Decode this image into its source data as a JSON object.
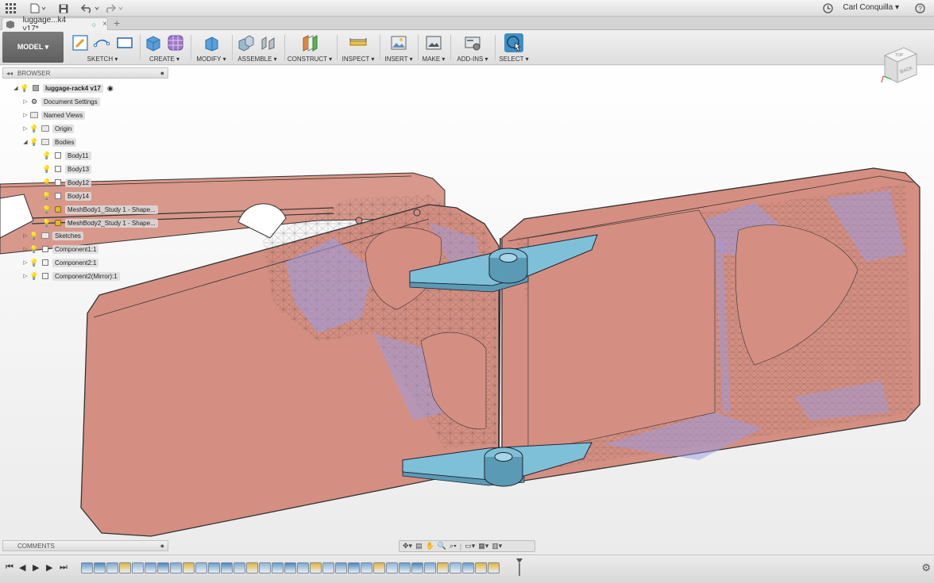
{
  "app": {
    "user_name": "Carl Conquilla ▾"
  },
  "tab": {
    "title": "luggage...k4 v17*",
    "status_dot": "○",
    "close": "×",
    "new_tab": "+"
  },
  "toolbar": {
    "model_label": "MODEL ▾",
    "groups": [
      {
        "label": "SKETCH ▾"
      },
      {
        "label": "CREATE ▾"
      },
      {
        "label": "MODIFY ▾"
      },
      {
        "label": "ASSEMBLE ▾"
      },
      {
        "label": "CONSTRUCT ▾"
      },
      {
        "label": "INSPECT ▾"
      },
      {
        "label": "INSERT ▾"
      },
      {
        "label": "MAKE ▾"
      },
      {
        "label": "ADD-INS ▾"
      },
      {
        "label": "SELECT ▾"
      }
    ]
  },
  "browser": {
    "header": "BROWSER",
    "root": "luggage-rack4 v17",
    "items": [
      {
        "label": "Document Settings"
      },
      {
        "label": "Named Views"
      },
      {
        "label": "Origin"
      },
      {
        "label": "Bodies"
      },
      {
        "label": "Body11"
      },
      {
        "label": "Body13"
      },
      {
        "label": "Body12"
      },
      {
        "label": "Body14"
      },
      {
        "label": "MeshBody1_Study 1 - Shape..."
      },
      {
        "label": "MeshBody2_Study 1 - Shape..."
      },
      {
        "label": "Sketches"
      },
      {
        "label": "Component1:1"
      },
      {
        "label": "Component2:1"
      },
      {
        "label": "Component2(Mirror):1"
      }
    ]
  },
  "navcube": {
    "face": "BACK",
    "top": "TOP"
  },
  "comments": {
    "label": "COMMENTS"
  },
  "colors": {
    "body_fill": "#d48f82",
    "mesh_blue": "#9a9ee8",
    "bracket_blue": "#7ec0d8",
    "select_blue": "#3f8fc4"
  }
}
